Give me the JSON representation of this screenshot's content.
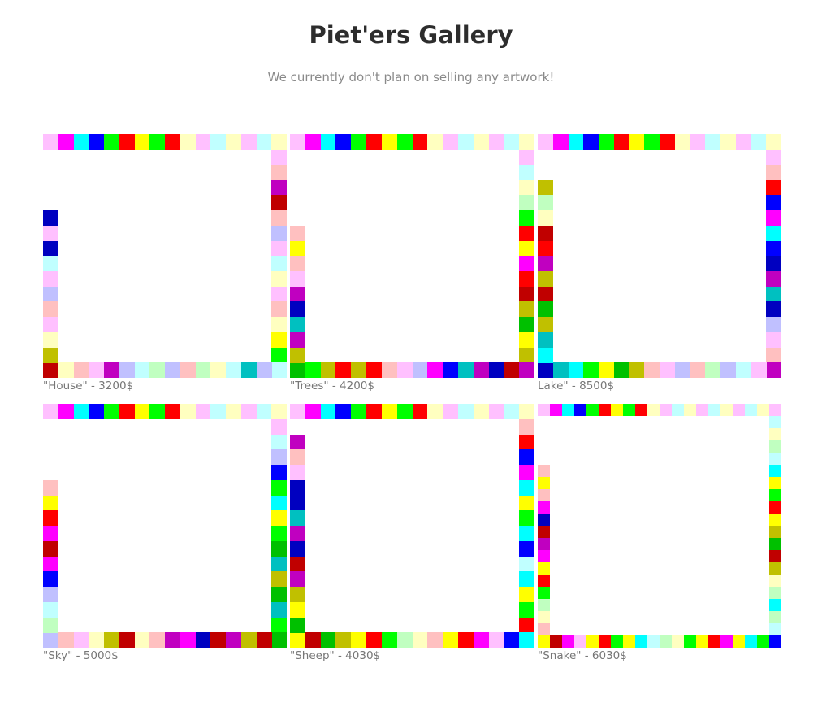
{
  "header": {
    "title": "Piet'ers Gallery",
    "subtitle": "We currently don't plan on selling any artwork!"
  },
  "palette": {
    "LR": "#ffc0c0",
    "LY": "#ffffc0",
    "LG": "#c0ffc0",
    "LC": "#c0ffff",
    "LB": "#c0c0ff",
    "LM": "#ffc0ff",
    "R": "#ff0000",
    "Y": "#ffff00",
    "G": "#00ff00",
    "C": "#00ffff",
    "B": "#0000ff",
    "M": "#ff00ff",
    "DR": "#c00000",
    "DY": "#c0c000",
    "DG": "#00c000",
    "DC": "#00c0c0",
    "DB": "#0000c0",
    "DM": "#c000c0"
  },
  "artworks": [
    {
      "name": "House",
      "price": "3200$",
      "caption": "\"House\" - 3200$",
      "grid": 16,
      "top": [
        "LM",
        "M",
        "C",
        "B",
        "G",
        "R",
        "Y",
        "G",
        "R",
        "LY",
        "LM",
        "LC",
        "LY",
        "LM",
        "LC",
        "LY"
      ],
      "right": [
        "LM",
        "LR",
        "DM",
        "DR",
        "LR",
        "LB",
        "LM",
        "LC",
        "LY",
        "LM",
        "LR",
        "LY",
        "Y",
        "G",
        "LC"
      ],
      "bottom": [
        "DR",
        "LY",
        "LR",
        "LM",
        "DM",
        "LB",
        "LC",
        "LG",
        "LB",
        "LR",
        "LG",
        "LY",
        "LC",
        "DC",
        "LB"
      ],
      "left": [
        "DB",
        "LM",
        "DB",
        "LC",
        "LM",
        "LB",
        "LR",
        "LM",
        "LY",
        "DY"
      ]
    },
    {
      "name": "Trees",
      "price": "4200$",
      "caption": "\"Trees\" - 4200$",
      "grid": 16,
      "top": [
        "LM",
        "M",
        "C",
        "B",
        "G",
        "R",
        "Y",
        "G",
        "R",
        "LY",
        "LM",
        "LC",
        "LY",
        "LM",
        "LC",
        "LY"
      ],
      "right": [
        "LM",
        "LC",
        "LY",
        "LG",
        "G",
        "R",
        "Y",
        "M",
        "R",
        "DR",
        "DY",
        "DG",
        "Y",
        "DY",
        "DM"
      ],
      "bottom": [
        "DG",
        "G",
        "DY",
        "R",
        "DY",
        "R",
        "LR",
        "LM",
        "LB",
        "M",
        "B",
        "DC",
        "DM",
        "DB",
        "DR"
      ],
      "left": [
        "LR",
        "Y",
        "LR",
        "LM",
        "DM",
        "DB",
        "DC",
        "DM",
        "DY"
      ]
    },
    {
      "name": "Lake",
      "price": "8500$",
      "caption": "Lake\" - 8500$",
      "grid": 16,
      "top": [
        "LM",
        "M",
        "C",
        "B",
        "G",
        "R",
        "Y",
        "G",
        "R",
        "LY",
        "LM",
        "LC",
        "LY",
        "LM",
        "LC",
        "LY"
      ],
      "right": [
        "LM",
        "LR",
        "R",
        "B",
        "M",
        "C",
        "B",
        "DB",
        "DM",
        "DC",
        "DB",
        "LB",
        "LM",
        "LR",
        "DM"
      ],
      "bottom": [
        "DB",
        "DC",
        "C",
        "G",
        "Y",
        "DG",
        "DY",
        "LR",
        "LM",
        "LB",
        "LR",
        "LG",
        "LB",
        "LC",
        "LM"
      ],
      "left": [
        "DY",
        "LG",
        "LY",
        "DR",
        "R",
        "DM",
        "DY",
        "DR",
        "DG",
        "DY",
        "DC",
        "C"
      ]
    },
    {
      "name": "Sky",
      "price": "5000$",
      "caption": "\"Sky\" - 5000$",
      "grid": 16,
      "top": [
        "LM",
        "M",
        "C",
        "B",
        "G",
        "R",
        "Y",
        "G",
        "R",
        "LY",
        "LM",
        "LC",
        "LY",
        "LM",
        "LC",
        "LY"
      ],
      "right": [
        "LM",
        "LC",
        "LB",
        "B",
        "G",
        "C",
        "Y",
        "G",
        "DG",
        "DC",
        "DY",
        "DG",
        "DC",
        "G",
        "DG"
      ],
      "bottom": [
        "LB",
        "LR",
        "LM",
        "LY",
        "DY",
        "DR",
        "LY",
        "LR",
        "DM",
        "M",
        "DB",
        "DR",
        "DM",
        "DY",
        "DR"
      ],
      "left": [
        "LR",
        "Y",
        "R",
        "M",
        "DR",
        "M",
        "B",
        "LB",
        "LC",
        "LG"
      ]
    },
    {
      "name": "Sheep",
      "price": "4030$",
      "caption": "\"Sheep\" - 4030$",
      "grid": 16,
      "top": [
        "LM",
        "M",
        "C",
        "B",
        "G",
        "R",
        "Y",
        "G",
        "R",
        "LY",
        "LM",
        "LC",
        "LY",
        "LM",
        "LC",
        "LY"
      ],
      "right": [
        "LR",
        "R",
        "B",
        "M",
        "C",
        "Y",
        "G",
        "C",
        "B",
        "LC",
        "C",
        "Y",
        "G",
        "R",
        "B"
      ],
      "bottom": [
        "Y",
        "DR",
        "DG",
        "DY",
        "Y",
        "R",
        "G",
        "LG",
        "LY",
        "LR",
        "Y",
        "R",
        "M",
        "LM",
        "B",
        "C"
      ],
      "left": [
        "DM",
        "LR",
        "LM",
        "DB",
        "DB",
        "DC",
        "DM",
        "DB",
        "DR",
        "DM",
        "DY",
        "Y",
        "DG"
      ]
    },
    {
      "name": "Snake",
      "price": "6030$",
      "caption": "\"Snake\" - 6030$",
      "grid": 20,
      "top": [
        "LM",
        "M",
        "C",
        "B",
        "G",
        "R",
        "Y",
        "G",
        "R",
        "LY",
        "LM",
        "LC",
        "LY",
        "LM",
        "LC",
        "LY",
        "LM",
        "LC",
        "LY",
        "LM"
      ],
      "right": [
        "LC",
        "LY",
        "LG",
        "LC",
        "C",
        "Y",
        "G",
        "R",
        "Y",
        "DY",
        "DG",
        "DR",
        "DY",
        "LY",
        "LG",
        "C",
        "LG",
        "LC"
      ],
      "bottom": [
        "Y",
        "DR",
        "M",
        "LM",
        "Y",
        "R",
        "G",
        "Y",
        "C",
        "LC",
        "LG",
        "LY",
        "G",
        "Y",
        "R",
        "M",
        "Y",
        "C",
        "G",
        "B"
      ],
      "left": [
        "LR",
        "Y",
        "LR",
        "M",
        "DB",
        "DR",
        "DM",
        "M",
        "Y",
        "R",
        "G",
        "LG",
        "LY",
        "LR"
      ]
    }
  ]
}
